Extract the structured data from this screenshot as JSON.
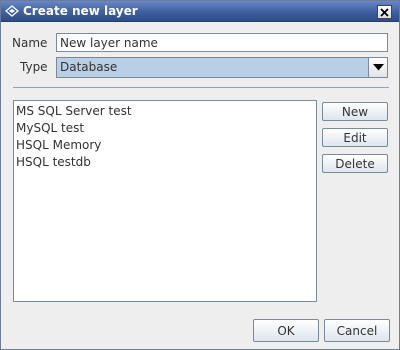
{
  "window": {
    "title": "Create new layer",
    "title_icon": "layers-diamond-icon",
    "close_icon": "close-icon"
  },
  "form": {
    "name_label": "Name",
    "name_value": "New layer name",
    "type_label": "Type",
    "type_value": "Database"
  },
  "connections": {
    "items": [
      "MS SQL Server test",
      "MySQL test",
      "HSQL Memory",
      "HSQL testdb"
    ]
  },
  "side_buttons": {
    "new_label": "New",
    "edit_label": "Edit",
    "delete_label": "Delete"
  },
  "footer": {
    "ok_label": "OK",
    "cancel_label": "Cancel"
  },
  "colors": {
    "titlebar": "#3e5f9f",
    "combo_selected_bg": "#b8cfe5",
    "dialog_bg": "#eeeeee"
  }
}
